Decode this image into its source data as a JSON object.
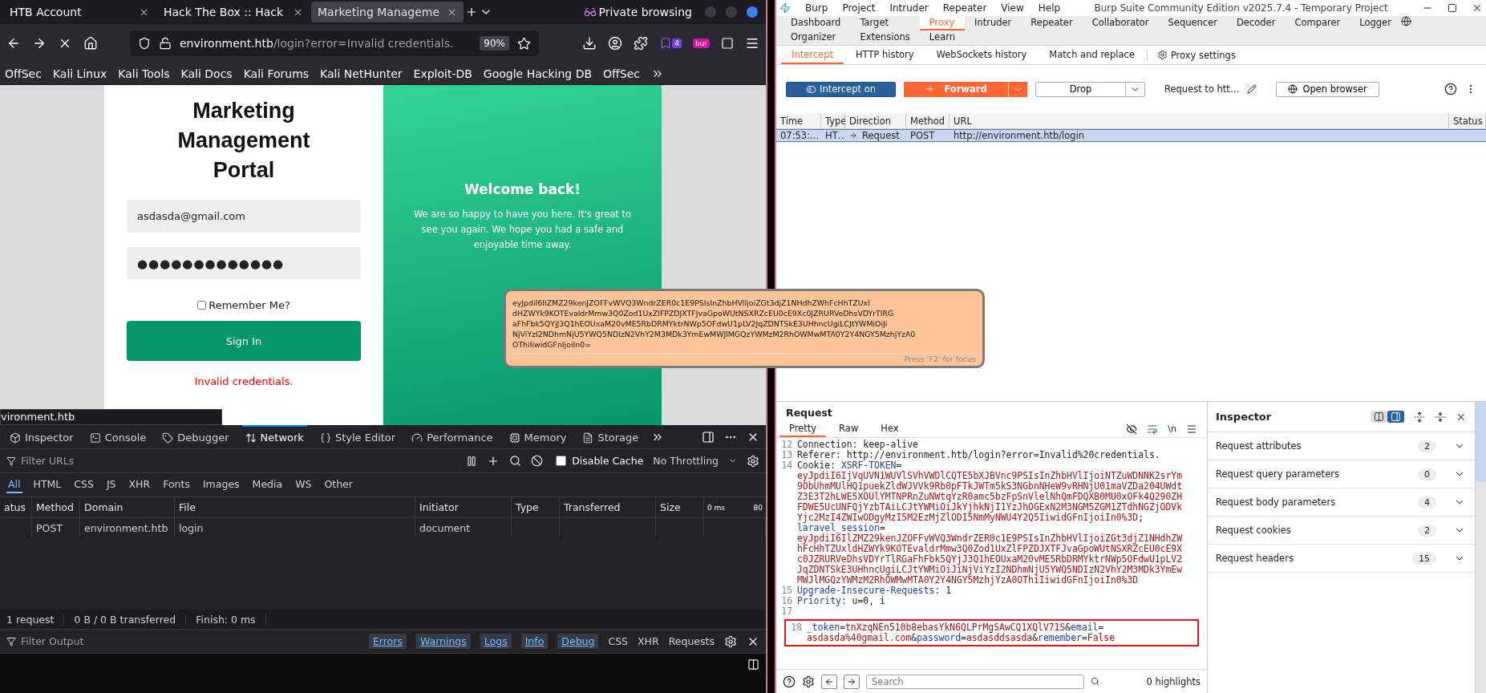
{
  "browser": {
    "tabs": [
      {
        "label": "HTB Account",
        "selected": false
      },
      {
        "label": "Hack The Box :: Hack",
        "selected": false
      },
      {
        "label": "Marketing Manageme",
        "selected": true
      }
    ],
    "private_label": "Private browsing",
    "url": {
      "host": "environment.htb",
      "path": "/login?error=Invalid credentials."
    },
    "zoom": "90%",
    "extension_badges": [
      "4",
      "bur"
    ],
    "bookmarks": [
      "OffSec",
      "Kali Linux",
      "Kali Tools",
      "Kali Docs",
      "Kali Forums",
      "Kali NetHunter",
      "Exploit-DB",
      "Google Hacking DB",
      "OffSec"
    ],
    "page": {
      "title": "Marketing Management Portal",
      "email": "asdasda@gmail.com",
      "password_mask": "●●●●●●●●●●●●●",
      "remember": {
        "label": "Remember Me?",
        "checked": false
      },
      "button": "Sign In",
      "error": "Invalid credentials.",
      "welcome_title": "Welcome back!",
      "welcome_text": "We are so happy to have you here. It's great to see you again. We hope you had a safe and enjoyable time away."
    },
    "status_link": "vironment.htb"
  },
  "devtools": {
    "tabs": [
      {
        "label": "Inspector",
        "selected": false
      },
      {
        "label": "Console",
        "selected": false
      },
      {
        "label": "Debugger",
        "selected": false
      },
      {
        "label": "Network",
        "selected": true
      },
      {
        "label": "Style Editor",
        "selected": false
      },
      {
        "label": "Performance",
        "selected": false
      },
      {
        "label": "Memory",
        "selected": false
      },
      {
        "label": "Storage",
        "selected": false
      }
    ],
    "filter_placeholder": "Filter URLs",
    "disable_cache": {
      "label": "Disable Cache",
      "checked": false
    },
    "throttling": "No Throttling",
    "type_filters": [
      {
        "label": "All",
        "selected": true
      },
      {
        "label": "HTML",
        "selected": false
      },
      {
        "label": "CSS",
        "selected": false
      },
      {
        "label": "JS",
        "selected": false
      },
      {
        "label": "XHR",
        "selected": false
      },
      {
        "label": "Fonts",
        "selected": false
      },
      {
        "label": "Images",
        "selected": false
      },
      {
        "label": "Media",
        "selected": false
      },
      {
        "label": "WS",
        "selected": false
      },
      {
        "label": "Other",
        "selected": false
      }
    ],
    "columns": [
      "atus",
      "Method",
      "Domain",
      "File",
      "Initiator",
      "Type",
      "Transferred",
      "Size"
    ],
    "timeline_ticks": [
      "0 ms",
      "80"
    ],
    "rows": [
      {
        "method": "POST",
        "domain": "environment.htb",
        "file": "login",
        "initiator": "document"
      }
    ],
    "summary": [
      "1 request",
      "0 B / 0 B transferred",
      "Finish: 0 ms"
    ],
    "console": {
      "filter_placeholder": "Filter Output",
      "levels": [
        {
          "label": "Errors",
          "selected": true
        },
        {
          "label": "Warnings",
          "selected": true
        },
        {
          "label": "Logs",
          "selected": true
        },
        {
          "label": "Info",
          "selected": true
        },
        {
          "label": "Debug",
          "selected": true
        }
      ],
      "others": [
        "CSS",
        "XHR",
        "Requests"
      ]
    }
  },
  "burp": {
    "menu": [
      "Burp",
      "Project",
      "Intruder",
      "Repeater",
      "View",
      "Help"
    ],
    "title": "Burp Suite Community Edition v2025.7.4 - Temporary Project",
    "tabs": [
      {
        "label": "Dashboard",
        "selected": false
      },
      {
        "label": "Target",
        "selected": false
      },
      {
        "label": "Proxy",
        "selected": true
      },
      {
        "label": "Intruder",
        "selected": false
      },
      {
        "label": "Repeater",
        "selected": false
      },
      {
        "label": "Collaborator",
        "selected": false
      },
      {
        "label": "Sequencer",
        "selected": false
      },
      {
        "label": "Decoder",
        "selected": false
      },
      {
        "label": "Comparer",
        "selected": false
      },
      {
        "label": "Logger",
        "selected": false
      },
      {
        "label": "Organizer",
        "selected": false
      },
      {
        "label": "Extensions",
        "selected": false
      },
      {
        "label": "Learn",
        "selected": false
      }
    ],
    "subtabs": [
      {
        "label": "Intercept",
        "selected": true
      },
      {
        "label": "HTTP history",
        "selected": false
      },
      {
        "label": "WebSockets history",
        "selected": false
      },
      {
        "label": "Match and replace",
        "selected": false
      }
    ],
    "proxy_settings": "Proxy settings",
    "intercept": {
      "label": "Intercept on",
      "on": true
    },
    "forward": "Forward",
    "drop": "Drop",
    "request_to": "Request to htt…",
    "open_browser": "Open browser",
    "queue": {
      "columns": [
        "Time",
        "Type",
        "Direction",
        "Method",
        "URL",
        "Status"
      ],
      "rows": [
        {
          "time": "07:53:…",
          "type": "HT…",
          "direction": "Request",
          "method": "POST",
          "url": "http://environment.htb/login",
          "selected": true
        }
      ]
    },
    "request": {
      "title": "Request",
      "tabs": [
        {
          "label": "Pretty",
          "selected": true
        },
        {
          "label": "Raw",
          "selected": false
        },
        {
          "label": "Hex",
          "selected": false
        }
      ],
      "lines": [
        {
          "num": "12",
          "parts": [
            {
              "kind": "plain",
              "text": "Connection: keep-alive"
            }
          ]
        },
        {
          "num": "13",
          "parts": [
            {
              "kind": "plain",
              "text": "Referer: http://environment.htb/login?error=Invalid%20credentials."
            }
          ]
        },
        {
          "num": "14",
          "parts": [
            {
              "kind": "plain",
              "text": "Cookie: "
            },
            {
              "kind": "param",
              "text": "XSRF-TOKEN"
            },
            {
              "kind": "plain",
              "text": "="
            }
          ]
        },
        {
          "parts": [
            {
              "kind": "value",
              "text": "eyJpdiI6IjVqUVN1WUVlSVhVWDlCQTE5bXJBVnc9PSIsInZhbHVlIjoiNTZuWDNNK2srYm"
            }
          ]
        },
        {
          "parts": [
            {
              "kind": "value",
              "text": "9ObUhmMUlHQ1puekZldWJVVk9Rb0pFTkJWTm5kS3NGbnNHeW9vRHNjU01maVZDa204UWdt"
            }
          ]
        },
        {
          "parts": [
            {
              "kind": "value",
              "text": "Z3E3T2hLWE5XOUlYMTNPRnZuNWtqYzR0amc5bzFpSnVlelNhQmFDQXB0MU0xOFk4Q290ZH"
            }
          ]
        },
        {
          "parts": [
            {
              "kind": "value",
              "text": "FDWE5UcUNFQjYzbTAiLCJtYWMiOiJkYjhkNjI1YzJhOGExN2M3NGM5ZGM1ZTdhNGZjODVk"
            }
          ]
        },
        {
          "parts": [
            {
              "kind": "value",
              "text": "Yjc2MzI4ZWIwODgyMzI5M2EzMjZlODI5NmMyNWU4Y2Q5IiwidGFnIjoiIn0%3D"
            },
            {
              "kind": "plain",
              "text": ";"
            }
          ]
        },
        {
          "parts": [
            {
              "kind": "param",
              "text": "laravel_session"
            },
            {
              "kind": "plain",
              "text": "="
            }
          ]
        },
        {
          "parts": [
            {
              "kind": "value",
              "text": "eyJpdiI6IlZMZ29kenJZOFFvWVQ3WndrZER0c1E9PSIsInZhbHVlIjoiZGt3djZ1NHdhZW"
            }
          ]
        },
        {
          "parts": [
            {
              "kind": "value",
              "text": "hFcHhTZUxldHZWYk9KOTEvaldrMmw3Q0Zod1UxZlFPZDJXTFJvaGpoWUtNSXRZcEU0cE9X"
            }
          ]
        },
        {
          "parts": [
            {
              "kind": "value",
              "text": "c0JZRURVeDhsVDYrTlRGaFhFbk5QYjJ3Q1hEOUxaM20vME5RbDRMYktrNWp5OFdwU1pLV2"
            }
          ]
        },
        {
          "parts": [
            {
              "kind": "value",
              "text": "JqZDNTSkE3UHhncUgiLCJtYWMiOiJiNjViYzI2NDhmNjU5YWQ5NDIzN2VhY2M3MDk3YmEw"
            }
          ]
        },
        {
          "parts": [
            {
              "kind": "value",
              "text": "MWJlMGQzYWMzM2RhOWMwMTA0Y2Y4NGY5MzhjYzA0OThiIiwidGFnIjoiIn0%3D"
            }
          ]
        },
        {
          "num": "15",
          "parts": [
            {
              "kind": "name",
              "text": "Upgrade-Insecure-Requests"
            },
            {
              "kind": "plain",
              "text": ": 1"
            }
          ]
        },
        {
          "num": "16",
          "parts": [
            {
              "kind": "name",
              "text": "Priority"
            },
            {
              "kind": "plain",
              "text": ": u=0, i"
            }
          ]
        },
        {
          "num": "17"
        },
        {
          "num": "18",
          "annotated": true,
          "parts": [
            {
              "kind": "param",
              "text": "_token"
            },
            {
              "kind": "plain",
              "text": "="
            },
            {
              "kind": "value",
              "text": "tnXzqNEn510b8ebasYkN6QLPrMgSAwCQ1XQlV71S"
            },
            {
              "kind": "plain",
              "text": "&"
            },
            {
              "kind": "param",
              "text": "email"
            },
            {
              "kind": "plain",
              "text": "="
            }
          ]
        },
        {
          "annotated": true,
          "parts": [
            {
              "kind": "value",
              "text": "asdasda%40gmail.com"
            },
            {
              "kind": "plain",
              "text": "&"
            },
            {
              "kind": "param",
              "text": "password"
            },
            {
              "kind": "plain",
              "text": "="
            },
            {
              "kind": "value",
              "text": "asdasddsasda"
            },
            {
              "kind": "plain",
              "text": "&"
            },
            {
              "kind": "param",
              "text": "remember"
            },
            {
              "kind": "plain",
              "text": "="
            },
            {
              "kind": "value",
              "text": "False"
            }
          ]
        }
      ],
      "newline_toggle": "\\n",
      "search_placeholder": "Search",
      "highlights": "0 highlights"
    },
    "inspector": {
      "title": "Inspector",
      "layout_options": [
        {
          "selected": false
        },
        {
          "selected": true
        }
      ],
      "sections": [
        {
          "label": "Request attributes",
          "count": "2"
        },
        {
          "label": "Request query parameters",
          "count": "0"
        },
        {
          "label": "Request body parameters",
          "count": "4"
        },
        {
          "label": "Request cookies",
          "count": "2"
        },
        {
          "label": "Request headers",
          "count": "15"
        }
      ]
    }
  },
  "tooltip": {
    "lines": [
      "eyJpdiI6IlZMZ29kenJZOFFvWVQ3WndrZER0c1E9PSIsInZhbHVlIjoiZGt3djZ1NHdhZWhFcHhTZUxl",
      "dHZWYk9KOTEvaldrMmw3Q0Zod1UxZlFPZDJXTFJvaGpoWUtNSXRZcEU0cE9Xc0JZRURVeDhsVDYrTlRG",
      "aFhFbk5QYjJ3Q1hEOUxaM20vME5RbDRMYktrNWp5OFdwU1pLV2JqZDNTSkE3UHhncUgiLCJtYWMiOiJi",
      "NjViYzI2NDhmNjU5YWQ5NDIzN2VhY2M3MDk3YmEwMWJlMGQzYWMzM2RhOWMwMTA0Y2Y4NGY5MzhjYzA0",
      "OThiIiwidGFnIjoiIn0="
    ],
    "hint": "Press 'F2' for focus"
  }
}
